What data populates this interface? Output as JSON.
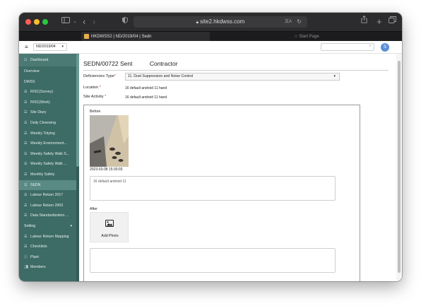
{
  "browser": {
    "url": "site2.hkdwss.com",
    "tabs": [
      {
        "label": "HKDWSS2 | ND/2019/04 | Sedn",
        "active": true
      },
      {
        "label": "Start Page",
        "active": false
      }
    ]
  },
  "header": {
    "project_select": "ND/2019/04",
    "avatar_letter": "S",
    "search_placeholder": ""
  },
  "sidebar": {
    "dashboard": "Dashboard",
    "items": [
      {
        "label": "Overview",
        "icon": "",
        "type": "plain"
      },
      {
        "label": "DWSS",
        "icon": "",
        "type": "plain"
      },
      {
        "label": "RISC(Survey)",
        "icon": "list-icon",
        "type": "item"
      },
      {
        "label": "RISC(Work)",
        "icon": "list-icon",
        "type": "item"
      },
      {
        "label": "Site Diary",
        "icon": "list-icon",
        "type": "item"
      },
      {
        "label": "Daily Cleansing",
        "icon": "list-icon",
        "type": "item"
      },
      {
        "label": "Weekly Tidying",
        "icon": "list-icon",
        "type": "item"
      },
      {
        "label": "Weekly Environment...",
        "icon": "list-icon",
        "type": "item"
      },
      {
        "label": "Weekly Safety Walk S...",
        "icon": "list-icon",
        "type": "item"
      },
      {
        "label": "Weekly Safety Walk ...",
        "icon": "list-icon",
        "type": "item"
      },
      {
        "label": "Monthly Safety",
        "icon": "list-icon",
        "type": "item"
      },
      {
        "label": "SEDN",
        "icon": "list-icon",
        "type": "active"
      },
      {
        "label": "Labour Return 2017",
        "icon": "list-icon",
        "type": "item"
      },
      {
        "label": "Labour Return 2003",
        "icon": "list-icon",
        "type": "item"
      },
      {
        "label": "Data Standardization ...",
        "icon": "list-icon",
        "type": "item"
      },
      {
        "label": "Setting",
        "icon": "",
        "type": "group"
      },
      {
        "label": "Labour Return Mapping",
        "icon": "list-icon",
        "type": "item"
      },
      {
        "label": "Checklists",
        "icon": "list-icon",
        "type": "item"
      },
      {
        "label": "Plant",
        "icon": "info-icon",
        "type": "item"
      },
      {
        "label": "Members",
        "icon": "members-icon",
        "type": "item"
      }
    ]
  },
  "page": {
    "title": "SEDN/00722 Sent",
    "role": "Contractor",
    "fields": {
      "deficiencies_label": "Deficiencies Type",
      "deficiencies_value": "11. Dust Suppression and Noise Control",
      "location_label": "Location",
      "location_value": "16 default android 11 hand",
      "site_activity_label": "Site Activity",
      "site_activity_value": "16 default android 11 hand",
      "required_mark": "*"
    },
    "before": {
      "label": "Before",
      "timestamp": "2023-03-08 15:30:03",
      "comment": "16 default android 11"
    },
    "after": {
      "label": "After",
      "add_photo": "Add Photo",
      "comment": ""
    }
  },
  "colors": {
    "sidebar_bg": "#3d6b66",
    "sidebar_active": "#5a8a84",
    "avatar": "#5b8fd8"
  }
}
